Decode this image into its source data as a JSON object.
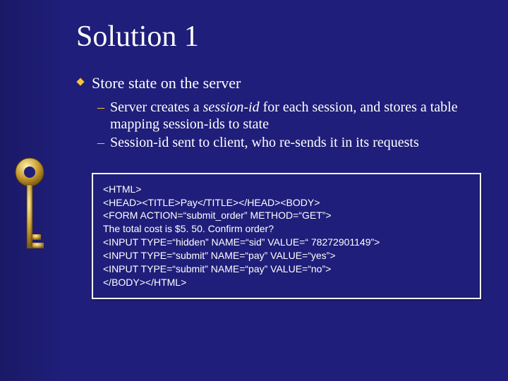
{
  "title": "Solution 1",
  "bullets": {
    "lvl1": "Store state on the server",
    "lvl2a_pre": "Server creates a ",
    "lvl2a_em": "session-id",
    "lvl2a_post": " for each session, and stores a table mapping session-ids to state",
    "lvl2b": "Session-id sent to client, who re-sends it in its requests"
  },
  "code": {
    "l1": "<HTML>",
    "l2": "<HEAD><TITLE>Pay</TITLE></HEAD><BODY>",
    "l3": "<FORM ACTION=“submit_order” METHOD=“GET”>",
    "l4": "The total cost is $5. 50. Confirm order?",
    "l5": "<INPUT TYPE=“hidden” NAME=“sid” VALUE=“ 78272901149”>",
    "l6": "<INPUT TYPE=“submit” NAME=“pay” VALUE=“yes”>",
    "l7": "<INPUT TYPE=“submit” NAME=“pay” VALUE=“no”>",
    "l8": "</BODY></HTML>"
  },
  "colors": {
    "bg": "#1f1e7a",
    "accent": "#f5c439"
  },
  "icons": {
    "key": "key-icon",
    "bullet": "diamond-bullet-icon"
  }
}
